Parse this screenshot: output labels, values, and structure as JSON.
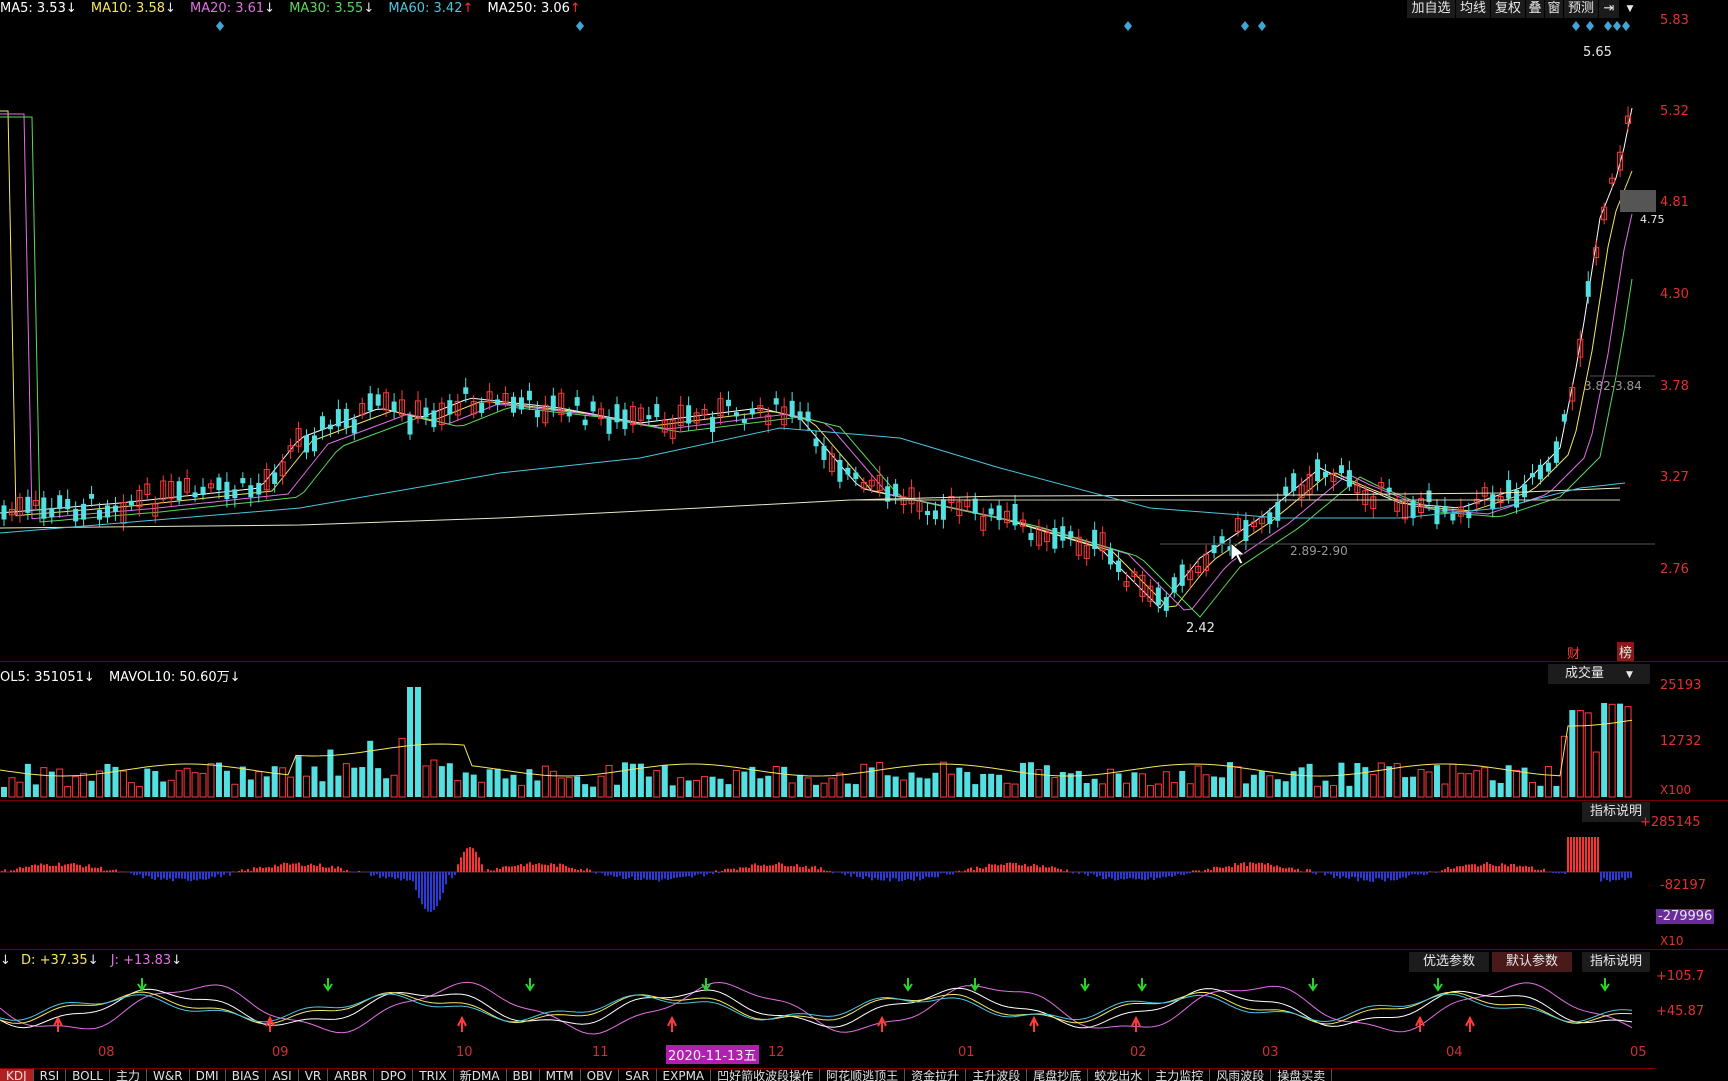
{
  "ma_legend": [
    {
      "label": "MA5: 3.53",
      "arrow": "↓",
      "color": "#ffffff",
      "arrow_color": "#e8e8e8"
    },
    {
      "label": "MA10: 3.58",
      "arrow": "↓",
      "color": "#f5e663",
      "arrow_color": "#e8e8e8"
    },
    {
      "label": "MA20: 3.61",
      "arrow": "↓",
      "color": "#e36fe6",
      "arrow_color": "#e8e8e8"
    },
    {
      "label": "MA30: 3.55",
      "arrow": "↓",
      "color": "#5cd85c",
      "arrow_color": "#e8e8e8"
    },
    {
      "label": "MA60: 3.42",
      "arrow": "↑",
      "color": "#4cc6e0",
      "arrow_color": "#ff3030"
    },
    {
      "label": "MA250: 3.06",
      "arrow": "↑",
      "color": "#ffffff",
      "arrow_color": "#ff3030"
    }
  ],
  "toolbar": {
    "items": [
      "加自选",
      "均线",
      "复权",
      "叠",
      "窗",
      "预测"
    ],
    "arrow_right": "⇥",
    "arrow_down": "▼"
  },
  "price_axis": [
    "5.83",
    "5.32",
    "4.81",
    "4.30",
    "3.78",
    "3.27",
    "2.76"
  ],
  "annotations": {
    "high": "5.65",
    "low": "2.42",
    "last": "4.75",
    "range1": "3.82-3.84",
    "range2": "2.89-2.90"
  },
  "badges": {
    "cai": "财",
    "bang": "榜"
  },
  "volume": {
    "legend_a": "OL5: 351051",
    "legend_a_arrow": "↓",
    "legend_b": "MAVOL10: 50.60万",
    "legend_b_arrow": "↓",
    "selector": "成交量",
    "axis": [
      "25193",
      "12732"
    ],
    "unit": "X100"
  },
  "macd": {
    "btn": "指标说明",
    "axis": [
      "+285145",
      "-82197",
      "-279996"
    ],
    "unit": "X10"
  },
  "kdj": {
    "legend_a": "D: +37.35",
    "legend_a_arrow": "↓",
    "legend_b": "J: +13.83",
    "legend_b_arrow": "↓",
    "axis": [
      "+105.7",
      "+45.87"
    ],
    "buttons": [
      "优选参数",
      "默认参数",
      "指标说明"
    ]
  },
  "month_ticks": [
    "08",
    "09",
    "10",
    "11",
    "12",
    "01",
    "02",
    "03",
    "04",
    "05"
  ],
  "date_badge": "2020-11-13五",
  "bottom_tabs": [
    "KDJ",
    "RSI",
    "BOLL",
    "主力",
    "W&R",
    "DMI",
    "BIAS",
    "ASI",
    "VR",
    "ARBR",
    "DPO",
    "TRIX",
    "新DMA",
    "BBI",
    "MTM",
    "OBV",
    "SAR",
    "EXPMA",
    "凹好箭收波段操作",
    "阿花顺逃顶王",
    "资金拉升",
    "主升波段",
    "尾盘抄底",
    "蛟龙出水",
    "主力监控",
    "风雨波段",
    "操盘买卖"
  ]
}
